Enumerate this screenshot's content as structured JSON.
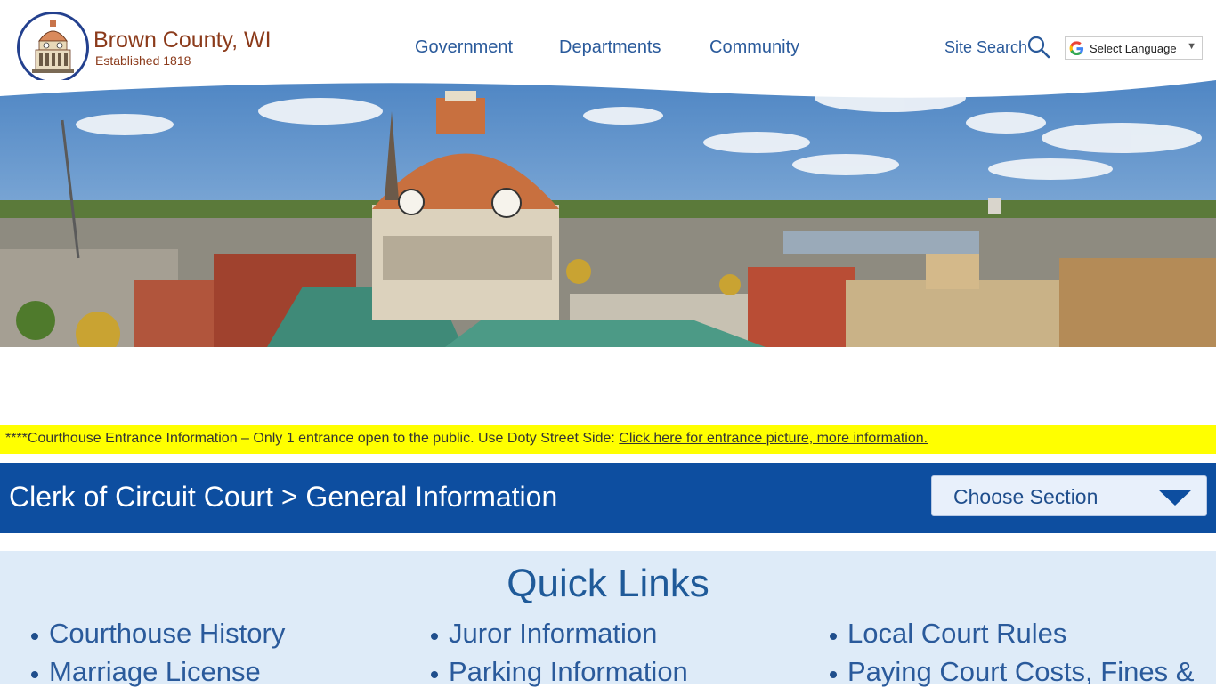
{
  "header": {
    "brand_name": "Brown County, WI",
    "brand_sub": "Established 1818",
    "nav": [
      "Government",
      "Departments",
      "Community"
    ],
    "site_search_label": "Site Search",
    "language_label": "Select Language"
  },
  "alert": {
    "text": "****Courthouse Entrance Information – Only 1 entrance open to the public. Use Doty Street Side: ",
    "link": "Click here for entrance picture, more information."
  },
  "titlebar": {
    "title": "Clerk of Circuit Court > General Information",
    "choose_section": "Choose Section"
  },
  "quick_links": {
    "heading": "Quick Links",
    "items": [
      "Courthouse History",
      "Juror Information",
      "Local Court Rules",
      "Marriage License",
      "Parking Information",
      "Paying Court Costs, Fines &"
    ]
  },
  "colors": {
    "brand_brown": "#8b3a1a",
    "nav_blue": "#2a5a9b",
    "titlebar_blue": "#0d4ea0",
    "alert_yellow": "#ffff00",
    "quick_bg": "#deebf8"
  }
}
